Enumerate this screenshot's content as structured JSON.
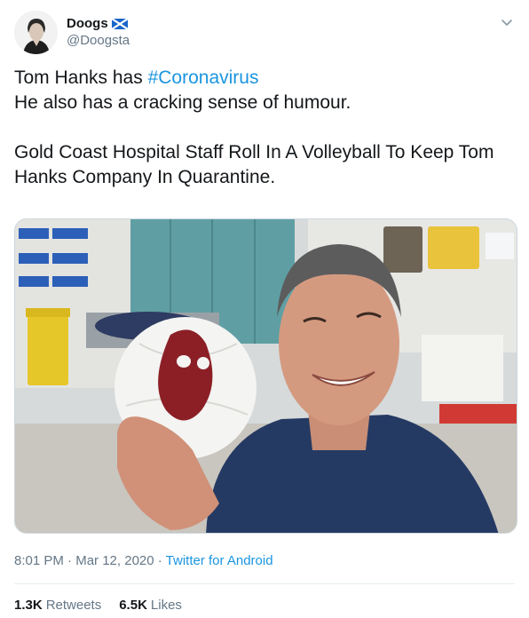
{
  "user": {
    "display_name": "Doogs",
    "handle": "@Doogsta",
    "flag_icon": "scotland-flag-icon"
  },
  "tweet": {
    "text_part1": "Tom Hanks has ",
    "hashtag": "#Coronavirus",
    "text_part2": "\nHe also has a cracking sense of humour.\n\nGold Coast Hospital Staff Roll In A Volleyball To Keep Tom Hanks Company In Quarantine."
  },
  "meta": {
    "time": "8:01 PM",
    "separator": " · ",
    "date": "Mar 12, 2020",
    "separator2": " · ",
    "source": "Twitter for Android"
  },
  "stats": {
    "retweets_count": "1.3K",
    "retweets_label": "Retweets",
    "likes_count": "6.5K",
    "likes_label": "Likes"
  },
  "colors": {
    "accent": "#1b95e0",
    "muted": "#657786",
    "text": "#14171a"
  }
}
